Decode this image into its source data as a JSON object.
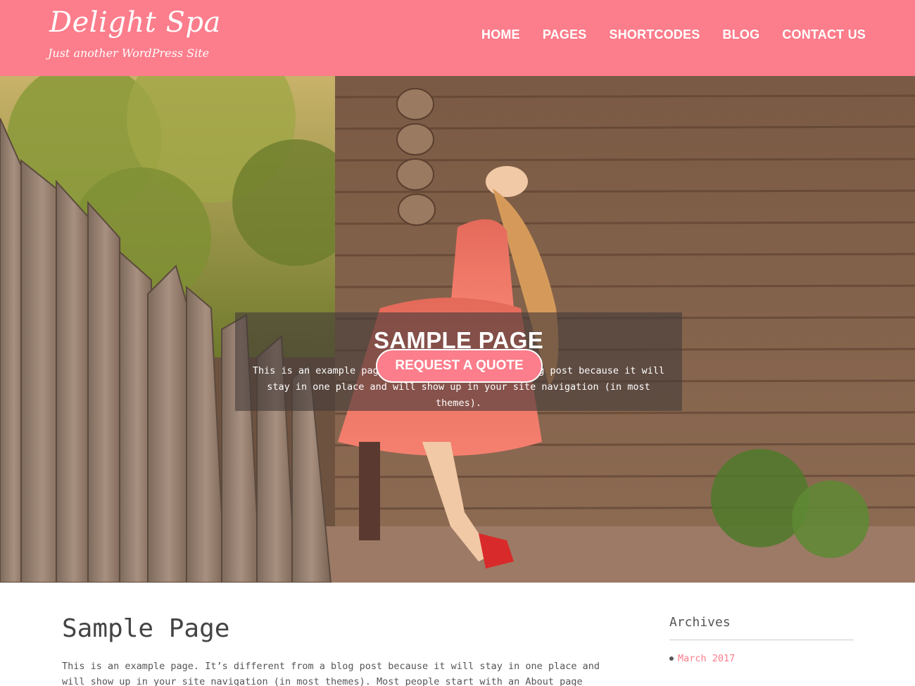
{
  "header": {
    "site_title": "Delight Spa",
    "tagline": "Just another WordPress Site",
    "nav": [
      {
        "label": "HOME"
      },
      {
        "label": "PAGES"
      },
      {
        "label": "SHORTCODES"
      },
      {
        "label": "BLOG"
      },
      {
        "label": "CONTACT US"
      }
    ]
  },
  "hero": {
    "title": "SAMPLE PAGE",
    "text": "This is an example page. It’s different from a blog post because it will stay in one place and will show up in your site navigation (in most themes).",
    "button_label": "REQUEST A QUOTE"
  },
  "content": {
    "heading": "Sample Page",
    "body": "This is an example page. It’s different from a blog post because it will stay in one place and will show up in your site navigation (in most themes). Most people start with an About page that"
  },
  "sidebar": {
    "widget_title": "Archives",
    "items": [
      {
        "label": "March 2017"
      }
    ]
  },
  "colors": {
    "brand_pink": "#fc7d8b",
    "text_dark": "#444444",
    "link": "#fc7d8b"
  }
}
